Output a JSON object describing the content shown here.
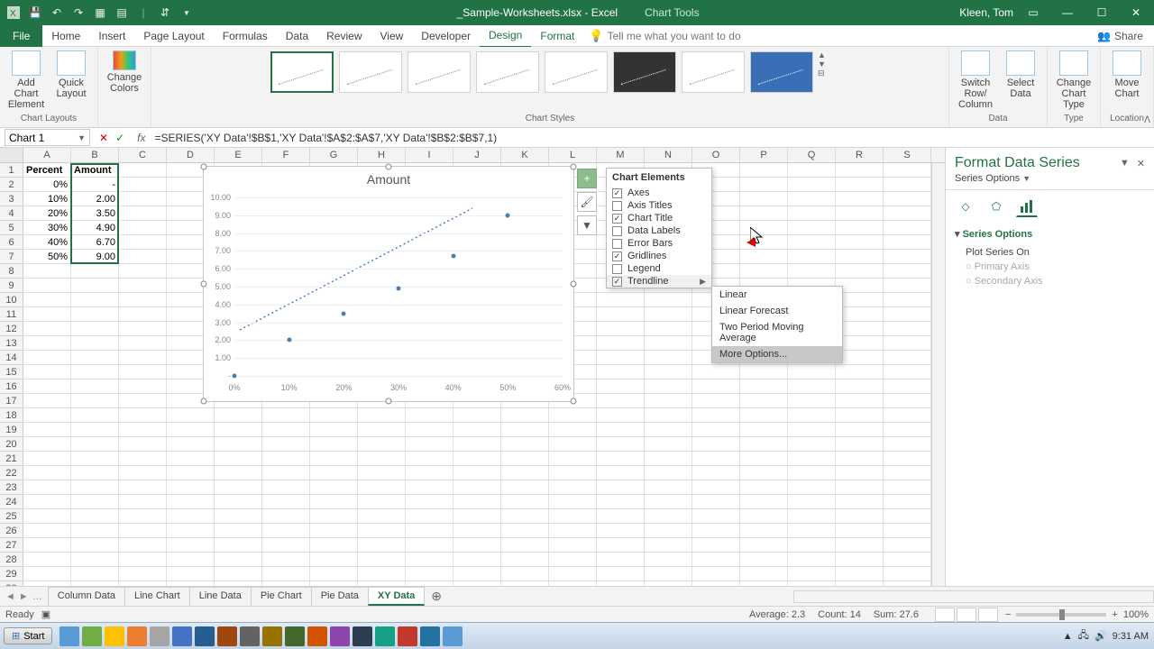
{
  "titlebar": {
    "doc_name": "_Sample-Worksheets.xlsx - Excel",
    "context_tab": "Chart Tools",
    "user": "Kleen, Tom"
  },
  "ribbon_tabs": {
    "file": "File",
    "tabs": [
      "Home",
      "Insert",
      "Page Layout",
      "Formulas",
      "Data",
      "Review",
      "View",
      "Developer"
    ],
    "context_tabs": [
      "Design",
      "Format"
    ],
    "active": "Design",
    "tellme": "Tell me what you want to do",
    "share": "Share"
  },
  "ribbon_groups": {
    "layouts": {
      "add_el": "Add Chart Element",
      "quick": "Quick Layout",
      "label": "Chart Layouts"
    },
    "colors": {
      "btn": "Change Colors"
    },
    "styles_label": "Chart Styles",
    "data": {
      "switch": "Switch Row/ Column",
      "select": "Select Data",
      "label": "Data"
    },
    "type": {
      "change": "Change Chart Type",
      "label": "Type"
    },
    "location": {
      "move": "Move Chart",
      "label": "Location"
    }
  },
  "namebox": "Chart 1",
  "formula": "=SERIES('XY Data'!$B$1,'XY Data'!$A$2:$A$7,'XY Data'!$B$2:$B$7,1)",
  "columns": [
    "A",
    "B",
    "C",
    "D",
    "E",
    "F",
    "G",
    "H",
    "I",
    "J",
    "K",
    "L",
    "M",
    "N",
    "O",
    "P",
    "Q",
    "R",
    "S"
  ],
  "table": {
    "headers": [
      "Percent",
      "Amount"
    ],
    "rows": [
      [
        "0%",
        "-"
      ],
      [
        "10%",
        "2.00"
      ],
      [
        "20%",
        "3.50"
      ],
      [
        "30%",
        "4.90"
      ],
      [
        "40%",
        "6.70"
      ],
      [
        "50%",
        "9.00"
      ]
    ]
  },
  "chart_data": {
    "type": "scatter",
    "title": "Amount",
    "x": [
      0,
      10,
      20,
      30,
      40,
      50
    ],
    "y": [
      0,
      2.0,
      3.5,
      4.9,
      6.7,
      9.0
    ],
    "xticks": [
      "0%",
      "10%",
      "20%",
      "30%",
      "40%",
      "50%",
      "60%"
    ],
    "yticks": [
      "-",
      "1.00",
      "2.00",
      "3.00",
      "4.00",
      "5.00",
      "6.00",
      "7.00",
      "8.00",
      "9.00",
      "10.00"
    ],
    "xlim": [
      0,
      60
    ],
    "ylim": [
      0,
      10
    ],
    "trendline": "linear-dotted"
  },
  "chart_elements": {
    "title": "Chart Elements",
    "items": [
      {
        "label": "Axes",
        "checked": true
      },
      {
        "label": "Axis Titles",
        "checked": false
      },
      {
        "label": "Chart Title",
        "checked": true
      },
      {
        "label": "Data Labels",
        "checked": false
      },
      {
        "label": "Error Bars",
        "checked": false
      },
      {
        "label": "Gridlines",
        "checked": true
      },
      {
        "label": "Legend",
        "checked": false
      },
      {
        "label": "Trendline",
        "checked": true,
        "submenu": true
      }
    ],
    "submenu": [
      "Linear",
      "Linear Forecast",
      "Two Period Moving Average",
      "More Options..."
    ],
    "submenu_hover": 3
  },
  "format_pane": {
    "title": "Format Data Series",
    "subtitle": "Series Options",
    "section": "Series Options",
    "label": "Plot Series On",
    "radios": [
      "Primary Axis",
      "Secondary Axis"
    ]
  },
  "sheet_tabs": [
    "Column Data",
    "Line Chart",
    "Line Data",
    "Pie Chart",
    "Pie Data",
    "XY Data"
  ],
  "sheet_active": 5,
  "status": {
    "ready": "Ready",
    "average": "Average: 2.3",
    "count": "Count: 14",
    "sum": "Sum: 27.6",
    "zoom": "100%"
  },
  "taskbar": {
    "start": "Start",
    "time": "9:31 AM",
    "date": "9:31 AM"
  }
}
